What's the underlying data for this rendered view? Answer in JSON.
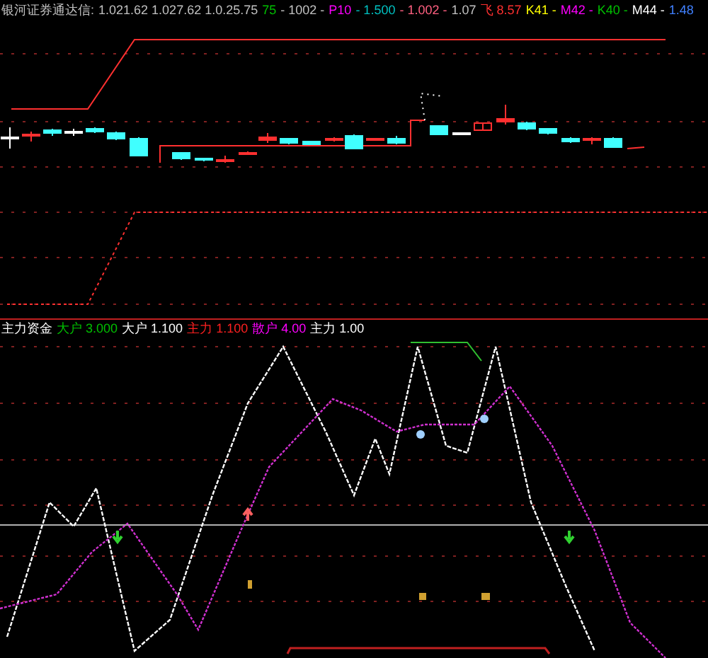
{
  "price_panel": {
    "title": "银河证券通达信:",
    "legend": [
      {
        "text": "1.021.62 1.027.62 1.0.25.75",
        "color": "#c0c0c0"
      },
      {
        "text": "75",
        "color": "#00c000"
      },
      {
        "text": "- 1002 -",
        "color": "#c0c0c0"
      },
      {
        "text": "P10",
        "color": "#ff00ff"
      },
      {
        "text": "- 1.500",
        "color": "#00c0c0"
      },
      {
        "text": "- 1.002 -",
        "color": "#ff6080"
      },
      {
        "text": "1.07",
        "color": "#c0c0c0"
      },
      {
        "text": "飞 8.57",
        "color": "#ff3030"
      },
      {
        "text": "K41 -",
        "color": "#ffff00"
      },
      {
        "text": "M42 -",
        "color": "#ff00ff"
      },
      {
        "text": "K40 -",
        "color": "#00c000"
      },
      {
        "text": "M44 -",
        "color": "#ffffff"
      },
      {
        "text": "1.48",
        "color": "#4080ff"
      }
    ]
  },
  "indicator_panel": {
    "legend": [
      {
        "text": "主力资金",
        "color": "#ffffff"
      },
      {
        "text": "大户 3.000",
        "color": "#00c000"
      },
      {
        "text": "大户 1.100",
        "color": "#ffffff"
      },
      {
        "text": "主力 1.100",
        "color": "#ff2020"
      },
      {
        "text": "散户 4.00",
        "color": "#ff00ff"
      },
      {
        "text": "主力 1.00",
        "color": "#ffffff"
      }
    ]
  }
}
